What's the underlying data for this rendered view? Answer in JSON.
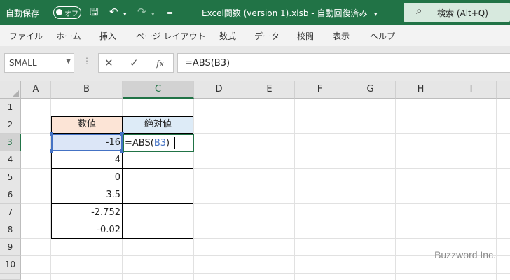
{
  "titlebar": {
    "autosave_label": "自動保存",
    "toggle_state": "オフ",
    "title": "Excel関数 (version 1).xlsb  -  自動回復済み",
    "search_label": "検索 (Alt+Q)",
    "colors": {
      "bar": "#217346"
    }
  },
  "ribbon": {
    "tabs": [
      "ファイル",
      "ホーム",
      "挿入",
      "ページ レイアウト",
      "数式",
      "データ",
      "校閲",
      "表示",
      "ヘルプ"
    ]
  },
  "formula_bar": {
    "name_box": "SMALL",
    "formula": "=ABS(B3)",
    "fx_label": "fx"
  },
  "sheet": {
    "columns": [
      "A",
      "B",
      "C",
      "D",
      "E",
      "F",
      "G",
      "H",
      "I"
    ],
    "rows": [
      "1",
      "2",
      "3",
      "4",
      "5",
      "6",
      "7",
      "8",
      "9",
      "10"
    ],
    "table": {
      "header_b": "数値",
      "header_c": "絶対値",
      "values": [
        "-16",
        "4",
        "0",
        "3.5",
        "-2.752",
        "-0.02"
      ],
      "edit_prefix": "=ABS(",
      "edit_ref": "B3",
      "edit_suffix": ")"
    },
    "colors": {
      "header_b_fill": "#fce4d6",
      "header_c_fill": "#ddebf7",
      "selection": "#217346",
      "ref_highlight": "#4472c4"
    }
  },
  "watermark": "Buzzword Inc."
}
